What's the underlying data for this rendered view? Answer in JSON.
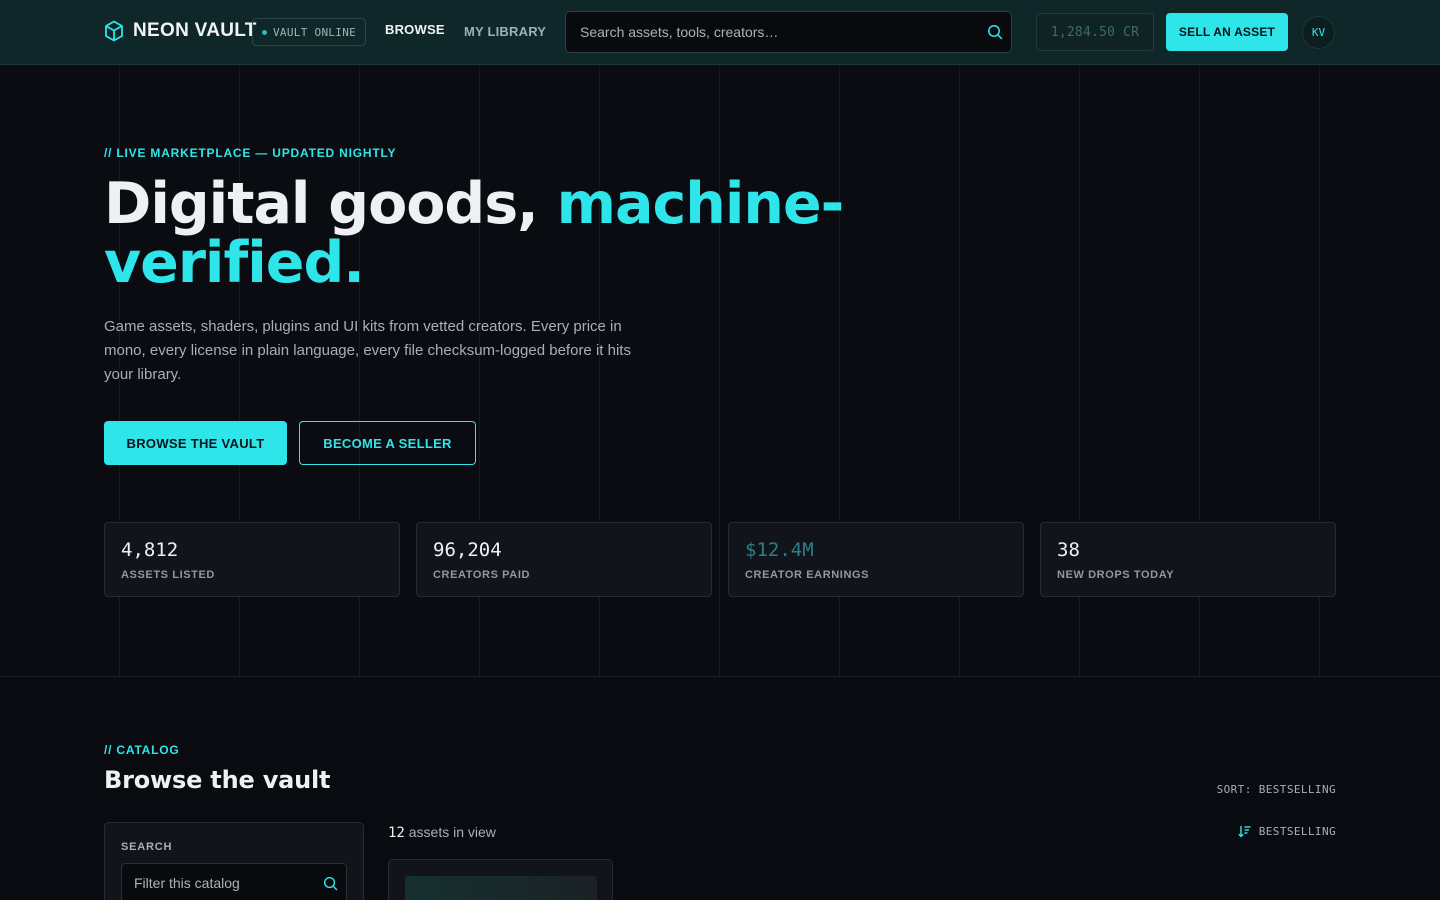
{
  "header": {
    "brand_name": "NEON VAULT",
    "status": "VAULT ONLINE",
    "nav": [
      {
        "label": "BROWSE"
      },
      {
        "label": "MY LIBRARY"
      }
    ],
    "search_placeholder": "Search assets, tools, creators…",
    "credits": "1,284.50 CR",
    "sell_label": "SELL AN ASSET",
    "avatar_initials": "KV"
  },
  "hero": {
    "eyebrow": "// LIVE MARKETPLACE — UPDATED NIGHTLY",
    "title_main": "Digital goods,",
    "title_accent": "machine-verified.",
    "description": "Game assets, shaders, plugins and UI kits from vetted creators. Every price in mono, every license in plain language, every file checksum-logged before it hits your library.",
    "primary_cta": "BROWSE THE VAULT",
    "secondary_cta": "BECOME A SELLER",
    "stats": [
      {
        "value": "4,812",
        "label": "ASSETS LISTED"
      },
      {
        "value": "96,204",
        "label": "CREATORS PAID"
      },
      {
        "value": "$12.4M",
        "label": "CREATOR EARNINGS"
      },
      {
        "value": "38",
        "label": "NEW DROPS TODAY"
      }
    ]
  },
  "catalog": {
    "eyebrow": "// CATALOG",
    "title": "Browse the vault",
    "sort_top": "SORT: BESTSELLING",
    "filter_label": "SEARCH",
    "filter_placeholder": "Filter this catalog",
    "asset_count": "12",
    "asset_count_suffix": "assets in view",
    "sort_button": "BESTSELLING"
  },
  "colors": {
    "accent": "#2ee6ea",
    "background": "#0a0b10",
    "header_bg": "#10272a",
    "panel": "#11141b"
  },
  "icons": {
    "brand": "cube-icon",
    "search": "search-icon",
    "sort": "sort-descending-icon"
  }
}
